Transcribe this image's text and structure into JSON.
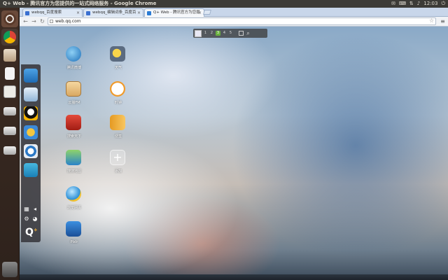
{
  "panel": {
    "window_title": "Q+ Web - 腾讯官方为您提供的一站式网络服务 - Google Chrome",
    "clock": "12:03"
  },
  "tabs": [
    {
      "label": "webqq_百度搜索"
    },
    {
      "label": "webqq_编辑词条_百度百"
    },
    {
      "label": "Q+ Web - 腾讯官方为您提"
    }
  ],
  "toolbar": {
    "url": "web.qq.com"
  },
  "page_switcher": {
    "pages": [
      "1",
      "2",
      "3",
      "4",
      "5"
    ],
    "active_page": "3"
  },
  "desktop_apps": [
    {
      "label": "腾讯微博"
    },
    {
      "label": "天气"
    },
    {
      "label": "云播FM"
    },
    {
      "label": "时钟"
    },
    {
      "label": "搜索天下"
    },
    {
      "label": "便签"
    },
    {
      "label": "搜搜地图"
    },
    {
      "label": "添加"
    },
    {
      "label": "浏览网页"
    },
    {
      "label": "Pixlr"
    }
  ],
  "dock": {
    "logo": "Q",
    "logo_sup": "+"
  },
  "colors": {
    "panel_bg": "#3c3b37",
    "launcher_bg": "#3d2c23",
    "tab_strip": "#c8d6ea",
    "switcher_active": "#6ab040"
  }
}
